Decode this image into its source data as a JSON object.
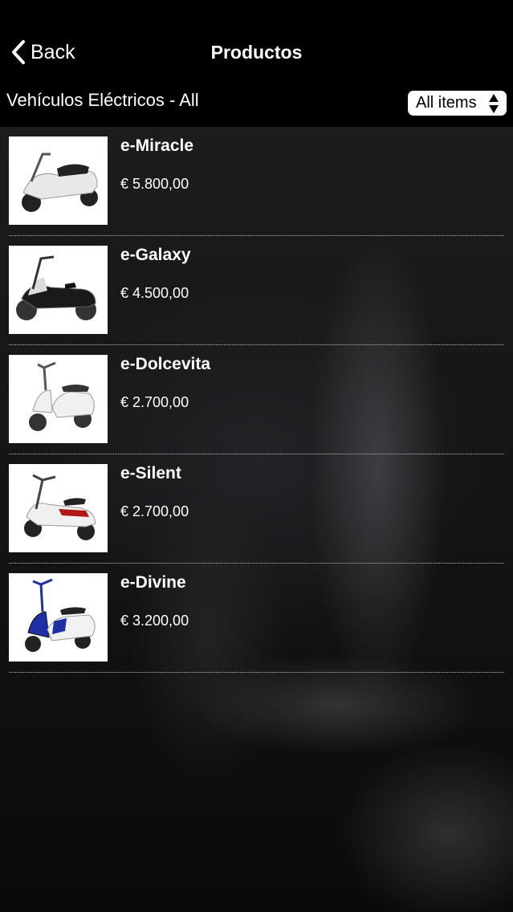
{
  "navbar": {
    "back_label": "Back",
    "title": "Productos"
  },
  "subheader": {
    "category": "Vehículos Eléctricos - All",
    "filter_value": "All items"
  },
  "products": [
    {
      "name": "e-Miracle",
      "price": "€ 5.800,00",
      "accent": "#e8e8e8"
    },
    {
      "name": "e-Galaxy",
      "price": "€ 4.500,00",
      "accent": "#1a1a1a"
    },
    {
      "name": "e-Dolcevita",
      "price": "€ 2.700,00",
      "accent": "#f0f0f0"
    },
    {
      "name": "e-Silent",
      "price": "€ 2.700,00",
      "accent": "#b01818"
    },
    {
      "name": "e-Divine",
      "price": "€ 3.200,00",
      "accent": "#1f2fa8"
    }
  ],
  "icons": {
    "back": "chevron-left-icon",
    "filter": "updown-arrows-icon"
  }
}
